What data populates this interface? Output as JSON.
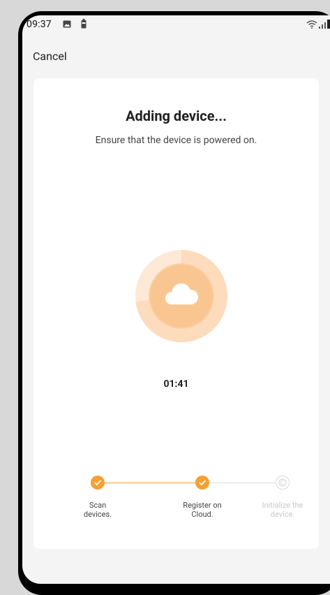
{
  "status_bar": {
    "time": "09:37",
    "icons": [
      "image-icon",
      "battery-icon",
      "wifi-icon",
      "signal-icon"
    ]
  },
  "header": {
    "cancel_label": "Cancel"
  },
  "main": {
    "title": "Adding device...",
    "subtitle": "Ensure that the device is powered on.",
    "timer": "01:41",
    "progress_icon": "cloud-icon"
  },
  "steps": [
    {
      "label_line1": "Scan",
      "label_line2": "devices.",
      "state": "done"
    },
    {
      "label_line1": "Register on",
      "label_line2": "Cloud.",
      "state": "done"
    },
    {
      "label_line1": "Initialize the",
      "label_line2": "device.",
      "state": "pending"
    }
  ],
  "colors": {
    "accent": "#f5a030",
    "ring_light": "#fde7d0",
    "ring_mid": "#fbd3ac",
    "inner": "#f8c08a",
    "pending": "#d9d9d9"
  }
}
